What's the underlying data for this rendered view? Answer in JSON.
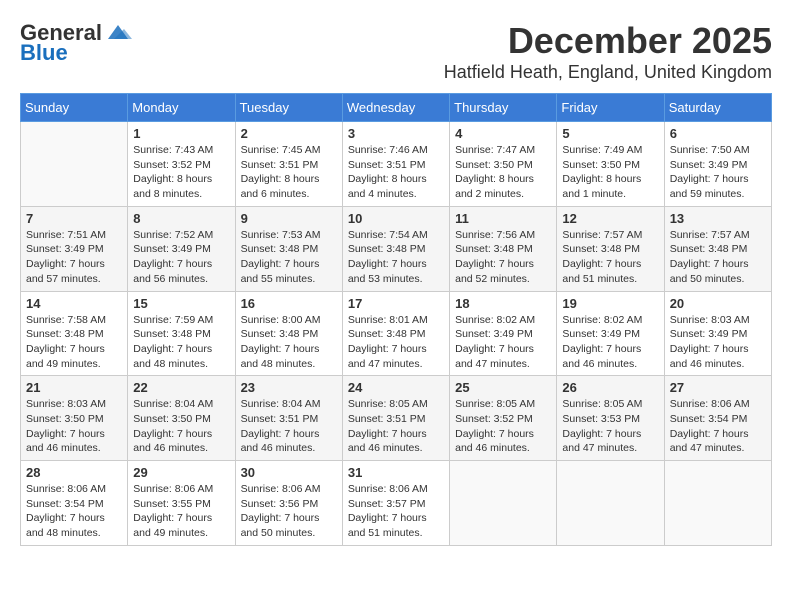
{
  "header": {
    "logo_general": "General",
    "logo_blue": "Blue",
    "month": "December 2025",
    "location": "Hatfield Heath, England, United Kingdom"
  },
  "weekdays": [
    "Sunday",
    "Monday",
    "Tuesday",
    "Wednesday",
    "Thursday",
    "Friday",
    "Saturday"
  ],
  "weeks": [
    [
      {
        "day": "",
        "info": ""
      },
      {
        "day": "1",
        "info": "Sunrise: 7:43 AM\nSunset: 3:52 PM\nDaylight: 8 hours\nand 8 minutes."
      },
      {
        "day": "2",
        "info": "Sunrise: 7:45 AM\nSunset: 3:51 PM\nDaylight: 8 hours\nand 6 minutes."
      },
      {
        "day": "3",
        "info": "Sunrise: 7:46 AM\nSunset: 3:51 PM\nDaylight: 8 hours\nand 4 minutes."
      },
      {
        "day": "4",
        "info": "Sunrise: 7:47 AM\nSunset: 3:50 PM\nDaylight: 8 hours\nand 2 minutes."
      },
      {
        "day": "5",
        "info": "Sunrise: 7:49 AM\nSunset: 3:50 PM\nDaylight: 8 hours\nand 1 minute."
      },
      {
        "day": "6",
        "info": "Sunrise: 7:50 AM\nSunset: 3:49 PM\nDaylight: 7 hours\nand 59 minutes."
      }
    ],
    [
      {
        "day": "7",
        "info": "Sunrise: 7:51 AM\nSunset: 3:49 PM\nDaylight: 7 hours\nand 57 minutes."
      },
      {
        "day": "8",
        "info": "Sunrise: 7:52 AM\nSunset: 3:49 PM\nDaylight: 7 hours\nand 56 minutes."
      },
      {
        "day": "9",
        "info": "Sunrise: 7:53 AM\nSunset: 3:48 PM\nDaylight: 7 hours\nand 55 minutes."
      },
      {
        "day": "10",
        "info": "Sunrise: 7:54 AM\nSunset: 3:48 PM\nDaylight: 7 hours\nand 53 minutes."
      },
      {
        "day": "11",
        "info": "Sunrise: 7:56 AM\nSunset: 3:48 PM\nDaylight: 7 hours\nand 52 minutes."
      },
      {
        "day": "12",
        "info": "Sunrise: 7:57 AM\nSunset: 3:48 PM\nDaylight: 7 hours\nand 51 minutes."
      },
      {
        "day": "13",
        "info": "Sunrise: 7:57 AM\nSunset: 3:48 PM\nDaylight: 7 hours\nand 50 minutes."
      }
    ],
    [
      {
        "day": "14",
        "info": "Sunrise: 7:58 AM\nSunset: 3:48 PM\nDaylight: 7 hours\nand 49 minutes."
      },
      {
        "day": "15",
        "info": "Sunrise: 7:59 AM\nSunset: 3:48 PM\nDaylight: 7 hours\nand 48 minutes."
      },
      {
        "day": "16",
        "info": "Sunrise: 8:00 AM\nSunset: 3:48 PM\nDaylight: 7 hours\nand 48 minutes."
      },
      {
        "day": "17",
        "info": "Sunrise: 8:01 AM\nSunset: 3:48 PM\nDaylight: 7 hours\nand 47 minutes."
      },
      {
        "day": "18",
        "info": "Sunrise: 8:02 AM\nSunset: 3:49 PM\nDaylight: 7 hours\nand 47 minutes."
      },
      {
        "day": "19",
        "info": "Sunrise: 8:02 AM\nSunset: 3:49 PM\nDaylight: 7 hours\nand 46 minutes."
      },
      {
        "day": "20",
        "info": "Sunrise: 8:03 AM\nSunset: 3:49 PM\nDaylight: 7 hours\nand 46 minutes."
      }
    ],
    [
      {
        "day": "21",
        "info": "Sunrise: 8:03 AM\nSunset: 3:50 PM\nDaylight: 7 hours\nand 46 minutes."
      },
      {
        "day": "22",
        "info": "Sunrise: 8:04 AM\nSunset: 3:50 PM\nDaylight: 7 hours\nand 46 minutes."
      },
      {
        "day": "23",
        "info": "Sunrise: 8:04 AM\nSunset: 3:51 PM\nDaylight: 7 hours\nand 46 minutes."
      },
      {
        "day": "24",
        "info": "Sunrise: 8:05 AM\nSunset: 3:51 PM\nDaylight: 7 hours\nand 46 minutes."
      },
      {
        "day": "25",
        "info": "Sunrise: 8:05 AM\nSunset: 3:52 PM\nDaylight: 7 hours\nand 46 minutes."
      },
      {
        "day": "26",
        "info": "Sunrise: 8:05 AM\nSunset: 3:53 PM\nDaylight: 7 hours\nand 47 minutes."
      },
      {
        "day": "27",
        "info": "Sunrise: 8:06 AM\nSunset: 3:54 PM\nDaylight: 7 hours\nand 47 minutes."
      }
    ],
    [
      {
        "day": "28",
        "info": "Sunrise: 8:06 AM\nSunset: 3:54 PM\nDaylight: 7 hours\nand 48 minutes."
      },
      {
        "day": "29",
        "info": "Sunrise: 8:06 AM\nSunset: 3:55 PM\nDaylight: 7 hours\nand 49 minutes."
      },
      {
        "day": "30",
        "info": "Sunrise: 8:06 AM\nSunset: 3:56 PM\nDaylight: 7 hours\nand 50 minutes."
      },
      {
        "day": "31",
        "info": "Sunrise: 8:06 AM\nSunset: 3:57 PM\nDaylight: 7 hours\nand 51 minutes."
      },
      {
        "day": "",
        "info": ""
      },
      {
        "day": "",
        "info": ""
      },
      {
        "day": "",
        "info": ""
      }
    ]
  ]
}
